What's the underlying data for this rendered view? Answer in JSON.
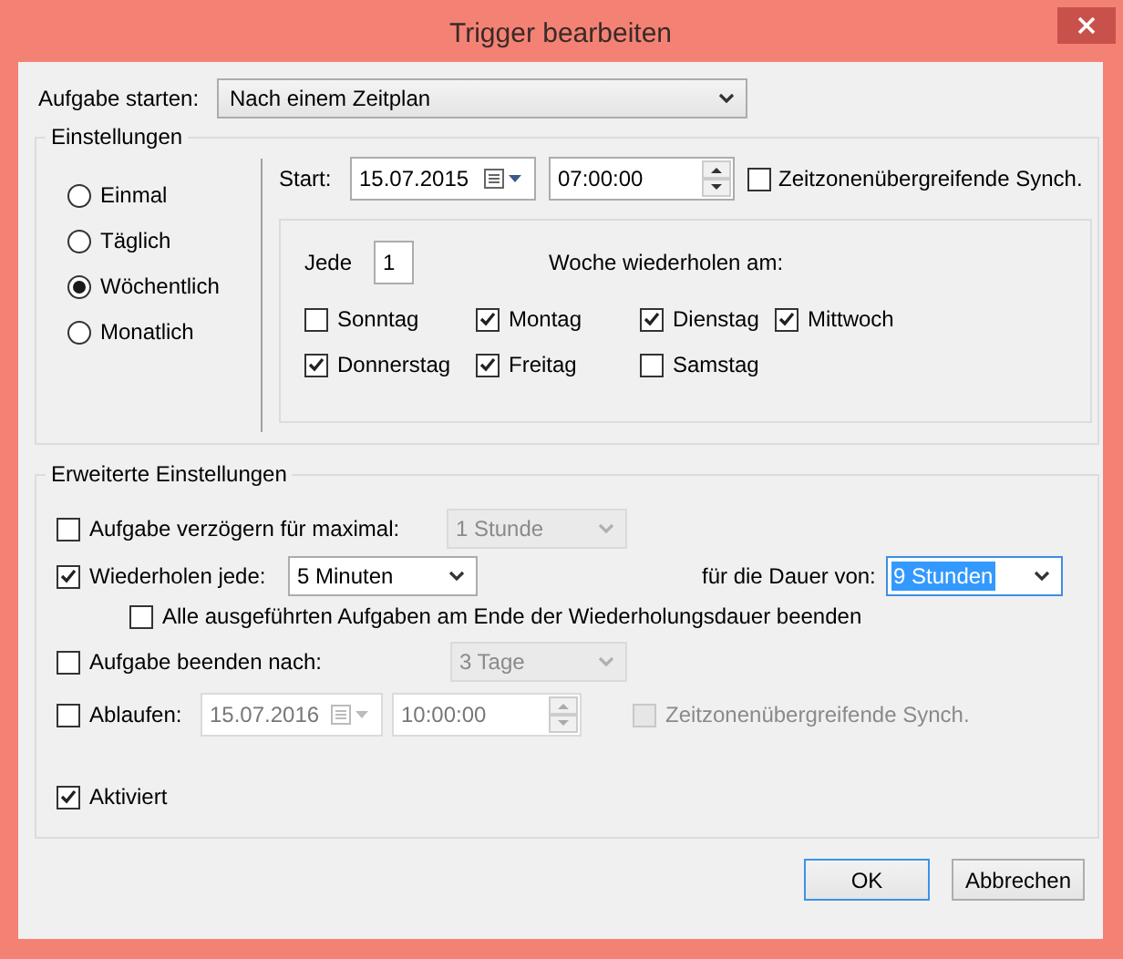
{
  "window": {
    "title": "Trigger bearbeiten"
  },
  "start_task": {
    "label": "Aufgabe starten:",
    "value": "Nach einem Zeitplan"
  },
  "settings": {
    "title": "Einstellungen",
    "schedule_options": [
      {
        "label": "Einmal",
        "selected": false
      },
      {
        "label": "Täglich",
        "selected": false
      },
      {
        "label": "Wöchentlich",
        "selected": true
      },
      {
        "label": "Monatlich",
        "selected": false
      }
    ],
    "start_label": "Start:",
    "start_date": "15.07.2015",
    "start_time": "07:00:00",
    "sync_timezones": {
      "label": "Zeitzonenübergreifende Synch.",
      "checked": false
    },
    "recur_label": "Jede",
    "recur_value": "1",
    "recur_suffix": "Woche wiederholen am:",
    "days": [
      {
        "label": "Sonntag",
        "checked": false
      },
      {
        "label": "Montag",
        "checked": true
      },
      {
        "label": "Dienstag",
        "checked": true
      },
      {
        "label": "Mittwoch",
        "checked": true
      },
      {
        "label": "Donnerstag",
        "checked": true
      },
      {
        "label": "Freitag",
        "checked": true
      },
      {
        "label": "Samstag",
        "checked": false
      }
    ]
  },
  "advanced": {
    "title": "Erweiterte Einstellungen",
    "delay": {
      "label": "Aufgabe verzögern für maximal:",
      "checked": false,
      "value": "1 Stunde"
    },
    "repeat": {
      "label": "Wiederholen jede:",
      "checked": true,
      "value": "5 Minuten",
      "duration_label": "für die Dauer von:",
      "duration_value": "9 Stunden",
      "duration_focused": true
    },
    "stop_all": {
      "label": "Alle ausgeführten Aufgaben am Ende der Wiederholungsdauer beenden",
      "checked": false
    },
    "stop_after": {
      "label": "Aufgabe beenden nach:",
      "checked": false,
      "value": "3 Tage"
    },
    "expire": {
      "label": "Ablaufen:",
      "checked": false,
      "date": "15.07.2016",
      "time": "10:00:00",
      "sync": {
        "label": "Zeitzonenübergreifende Synch.",
        "checked": false
      }
    },
    "enabled": {
      "label": "Aktiviert",
      "checked": true
    }
  },
  "buttons": [
    {
      "label": "OK",
      "default": true
    },
    {
      "label": "Abbrechen",
      "default": false
    }
  ]
}
